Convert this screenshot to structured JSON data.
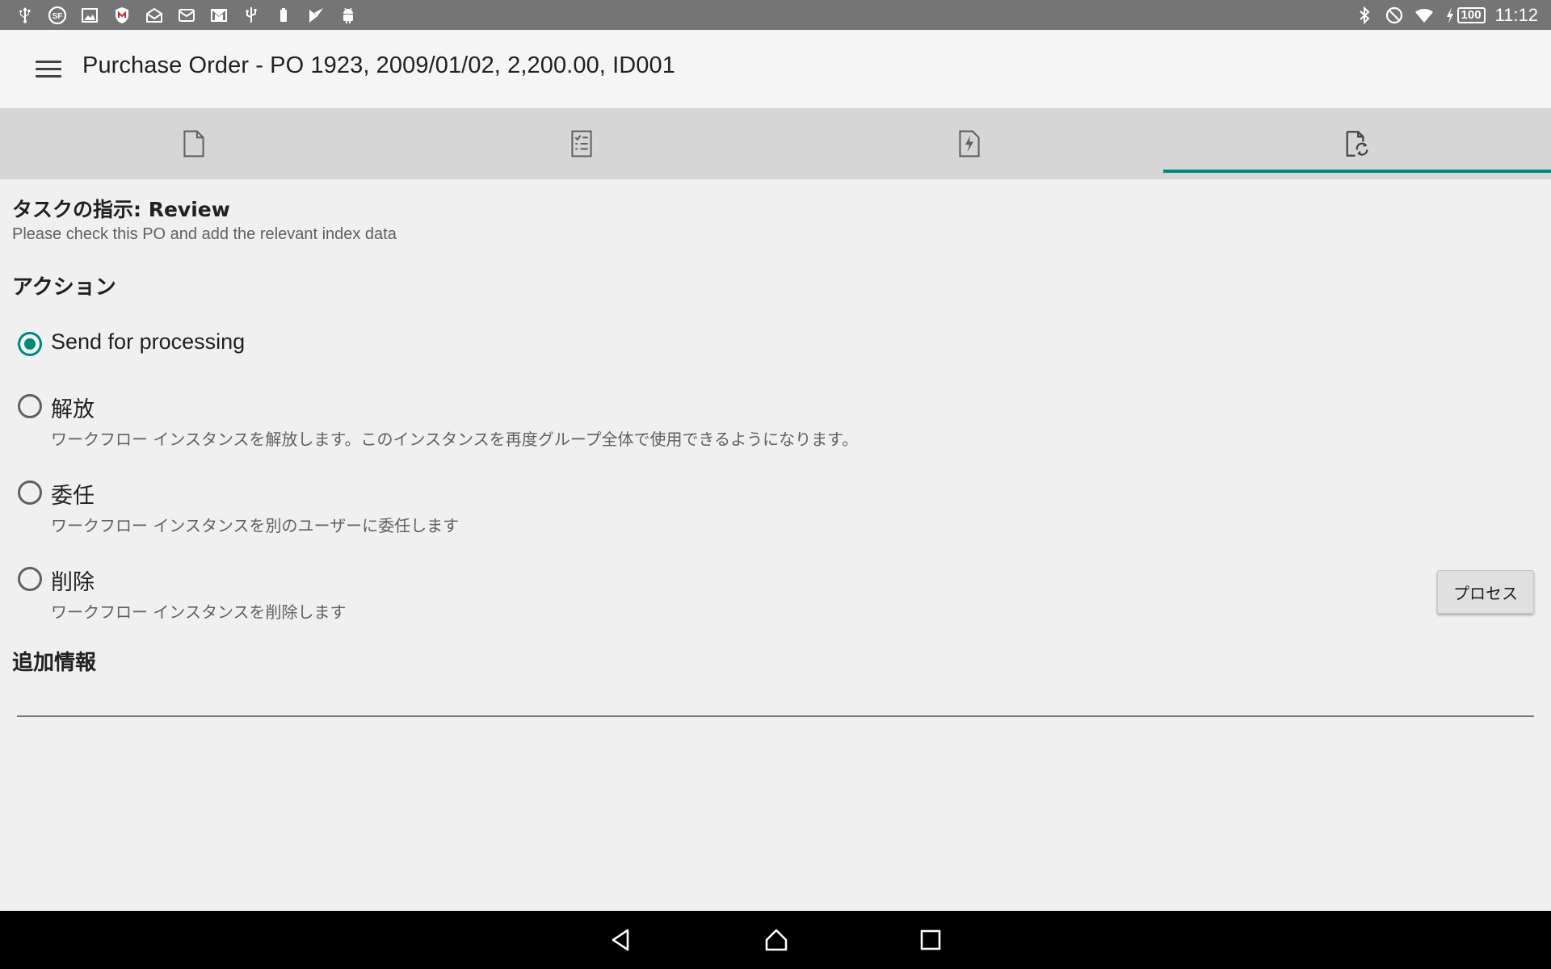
{
  "status_bar": {
    "left_icons": [
      "usb-icon",
      "sf-icon",
      "image-icon",
      "mcafee-icon",
      "mail-open-icon",
      "email-icon",
      "gmail-icon",
      "usb-debug-icon",
      "battery-saver-icon",
      "play-store-icon",
      "android-icon"
    ],
    "battery_level": "100",
    "time": "11:12",
    "right_icons": [
      "bluetooth-icon",
      "do-not-disturb-icon",
      "wifi-icon",
      "charging-icon"
    ]
  },
  "app_bar": {
    "title": "Purchase Order - PO 1923, 2009/01/02, 2,200.00, ID001"
  },
  "tabs": [
    {
      "icon": "document-icon",
      "active": false
    },
    {
      "icon": "checklist-icon",
      "active": false
    },
    {
      "icon": "document-lightning-icon",
      "active": false
    },
    {
      "icon": "document-workflow-icon",
      "active": true
    }
  ],
  "task": {
    "heading": "タスクの指示: Review",
    "description": "Please check this PO and add the relevant index data"
  },
  "actions": {
    "heading": "アクション",
    "options": [
      {
        "label": "Send for processing",
        "description": "",
        "checked": true
      },
      {
        "label": "解放",
        "description": "ワークフロー インスタンスを解放します。このインスタンスを再度グループ全体で使用できるようになります。",
        "checked": false
      },
      {
        "label": "委任",
        "description": "ワークフロー インスタンスを別のユーザーに委任します",
        "checked": false
      },
      {
        "label": "削除",
        "description": "ワークフロー インスタンスを削除します",
        "checked": false
      }
    ],
    "process_button": "プロセス"
  },
  "extra_info": {
    "heading": "追加情報",
    "value": ""
  },
  "colors": {
    "accent": "#00897b",
    "status_bar": "#757575",
    "tab_bar": "#d6d6d6",
    "background": "#f0f0f0"
  }
}
